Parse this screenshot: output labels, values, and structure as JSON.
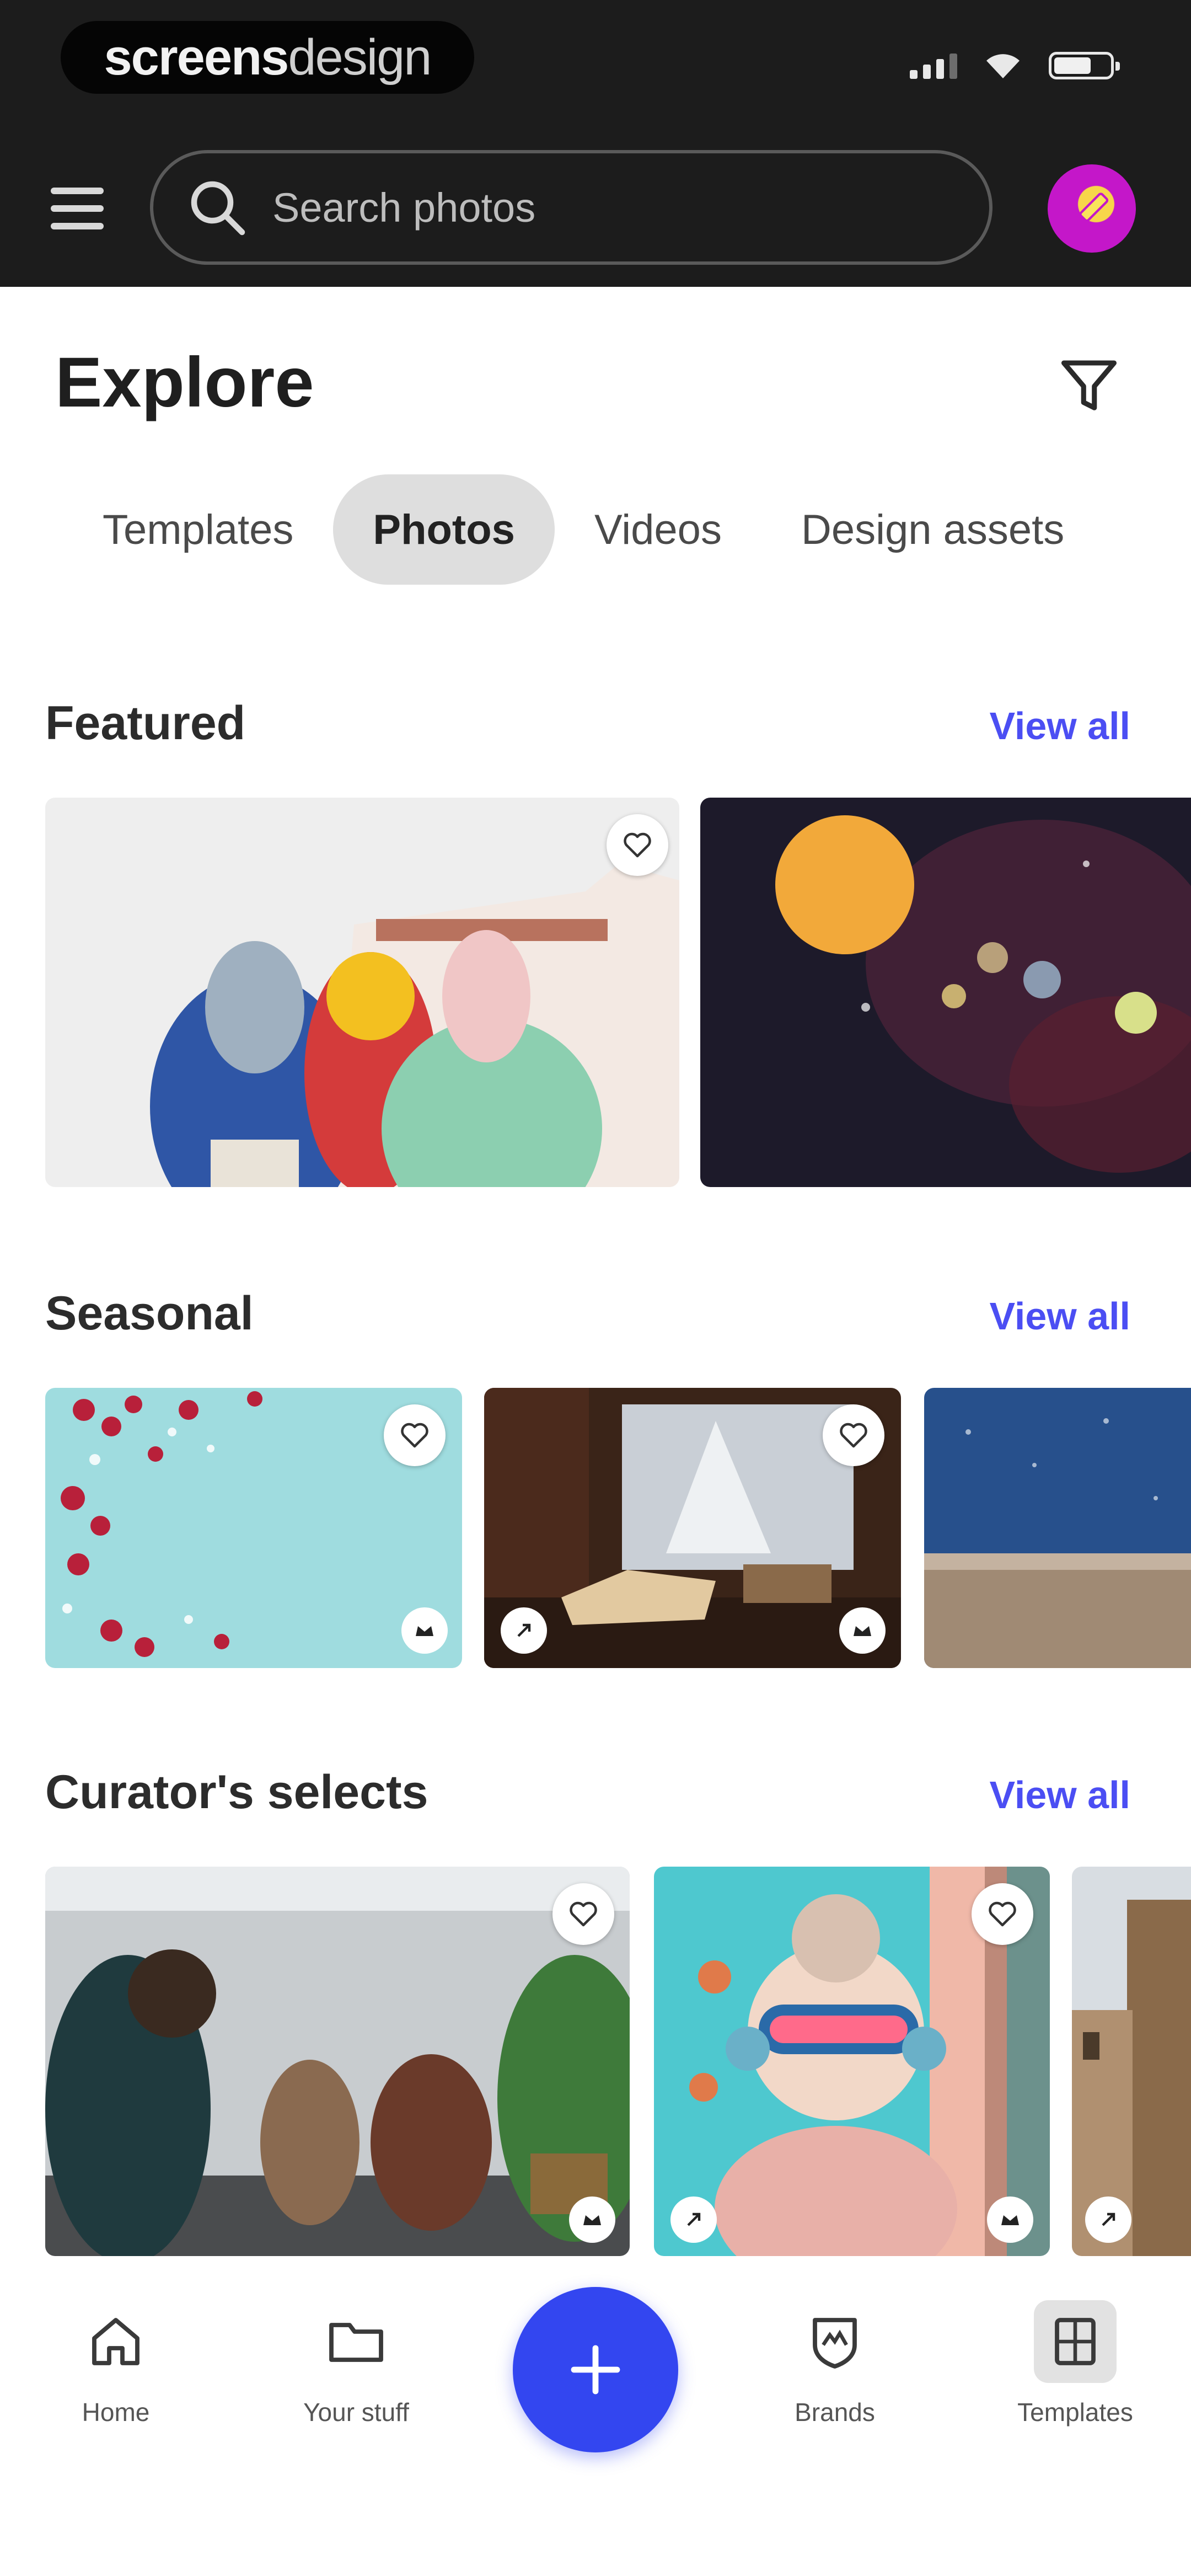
{
  "status_bar": {
    "logo_bold": "screens",
    "logo_thin": "design",
    "icons": [
      "signal-icon",
      "wifi-icon",
      "battery-icon"
    ]
  },
  "header": {
    "menu_icon": "hamburger-menu-icon",
    "search_placeholder": "Search photos",
    "avatar_icon": "user-avatar"
  },
  "page": {
    "title": "Explore",
    "filter_icon": "filter-icon"
  },
  "tabs": [
    {
      "label": "Templates",
      "active": false
    },
    {
      "label": "Photos",
      "active": true
    },
    {
      "label": "Videos",
      "active": false
    },
    {
      "label": "Design assets",
      "active": false
    }
  ],
  "sections": {
    "featured": {
      "title": "Featured",
      "view_all": "View all"
    },
    "seasonal": {
      "title": "Seasonal",
      "view_all": "View all"
    },
    "curators": {
      "title": "Curator's selects",
      "view_all": "View all"
    }
  },
  "bottom_nav": {
    "home": "Home",
    "your_stuff": "Your stuff",
    "create_icon": "plus-icon",
    "brands": "Brands",
    "templates": "Templates",
    "active": "Templates"
  },
  "colors": {
    "accent": "#3346f0",
    "link": "#4b4ef3",
    "header_bg": "#1c1c1c"
  }
}
